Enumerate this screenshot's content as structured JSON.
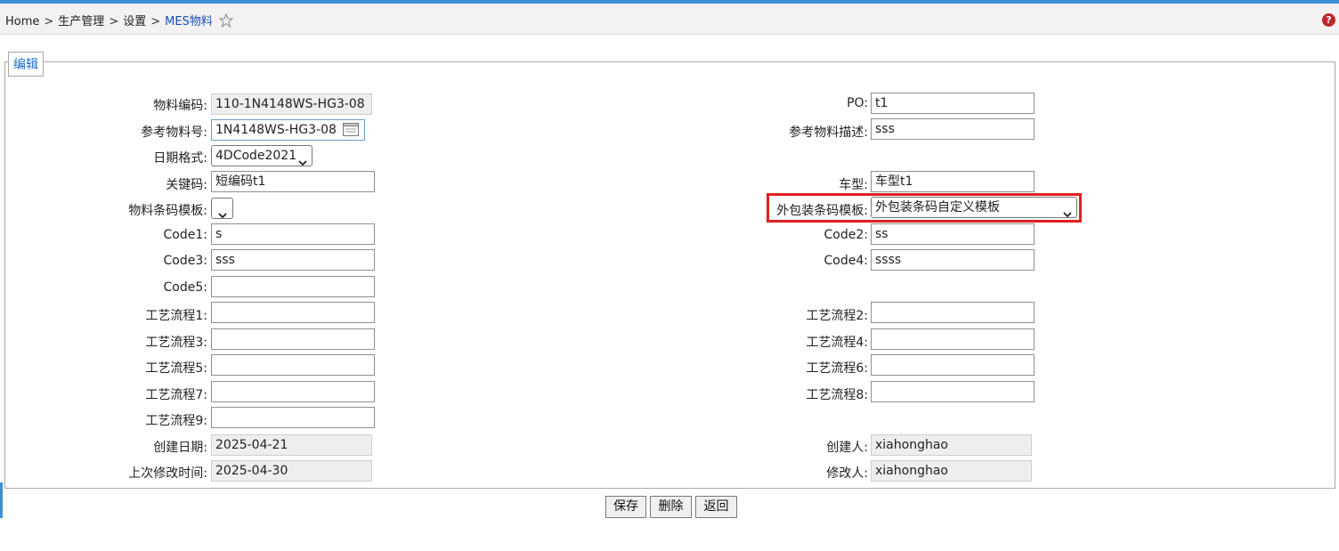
{
  "breadcrumb": {
    "home": "Home",
    "separator": ">",
    "level1": "生产管理",
    "level2": "设置",
    "current": "MES物料"
  },
  "help_label": "?",
  "legend": "编辑",
  "form": {
    "material_code": {
      "label": "物料编码:",
      "value": "110-1N4148WS-HG3-08"
    },
    "po": {
      "label": "PO:",
      "value": "t1"
    },
    "ref_material_no": {
      "label": "参考物料号:",
      "value": "1N4148WS-HG3-08"
    },
    "ref_material_desc": {
      "label": "参考物料描述:",
      "value": "sss"
    },
    "date_format": {
      "label": "日期格式:",
      "value": "4DCode2021"
    },
    "keycode": {
      "label": "关键码:",
      "value": "短编码t1"
    },
    "car_model": {
      "label": "车型:",
      "value": "车型t1"
    },
    "material_barcode_template": {
      "label": "物料条码模板:",
      "value": ""
    },
    "outer_barcode_template": {
      "label": "外包装条码模板:",
      "value": "外包装条码自定义模板"
    },
    "code1": {
      "label": "Code1:",
      "value": "s"
    },
    "code2": {
      "label": "Code2:",
      "value": "ss"
    },
    "code3": {
      "label": "Code3:",
      "value": "sss"
    },
    "code4": {
      "label": "Code4:",
      "value": "ssss"
    },
    "code5": {
      "label": "Code5:",
      "value": ""
    },
    "process1": {
      "label": "工艺流程1:",
      "value": ""
    },
    "process2": {
      "label": "工艺流程2:",
      "value": ""
    },
    "process3": {
      "label": "工艺流程3:",
      "value": ""
    },
    "process4": {
      "label": "工艺流程4:",
      "value": ""
    },
    "process5": {
      "label": "工艺流程5:",
      "value": ""
    },
    "process6": {
      "label": "工艺流程6:",
      "value": ""
    },
    "process7": {
      "label": "工艺流程7:",
      "value": ""
    },
    "process8": {
      "label": "工艺流程8:",
      "value": ""
    },
    "process9": {
      "label": "工艺流程9:",
      "value": ""
    },
    "created_date": {
      "label": "创建日期:",
      "value": "2025-04-21"
    },
    "creator": {
      "label": "创建人:",
      "value": "xiahonghao"
    },
    "modified_time": {
      "label": "上次修改时间:",
      "value": "2025-04-30"
    },
    "modifier": {
      "label": "修改人:",
      "value": "xiahonghao"
    }
  },
  "buttons": {
    "save": "保存",
    "delete": "删除",
    "back": "返回"
  },
  "colors": {
    "accent": "#3c8fd6",
    "highlight": "#e02020",
    "link": "#1a4fb5"
  }
}
